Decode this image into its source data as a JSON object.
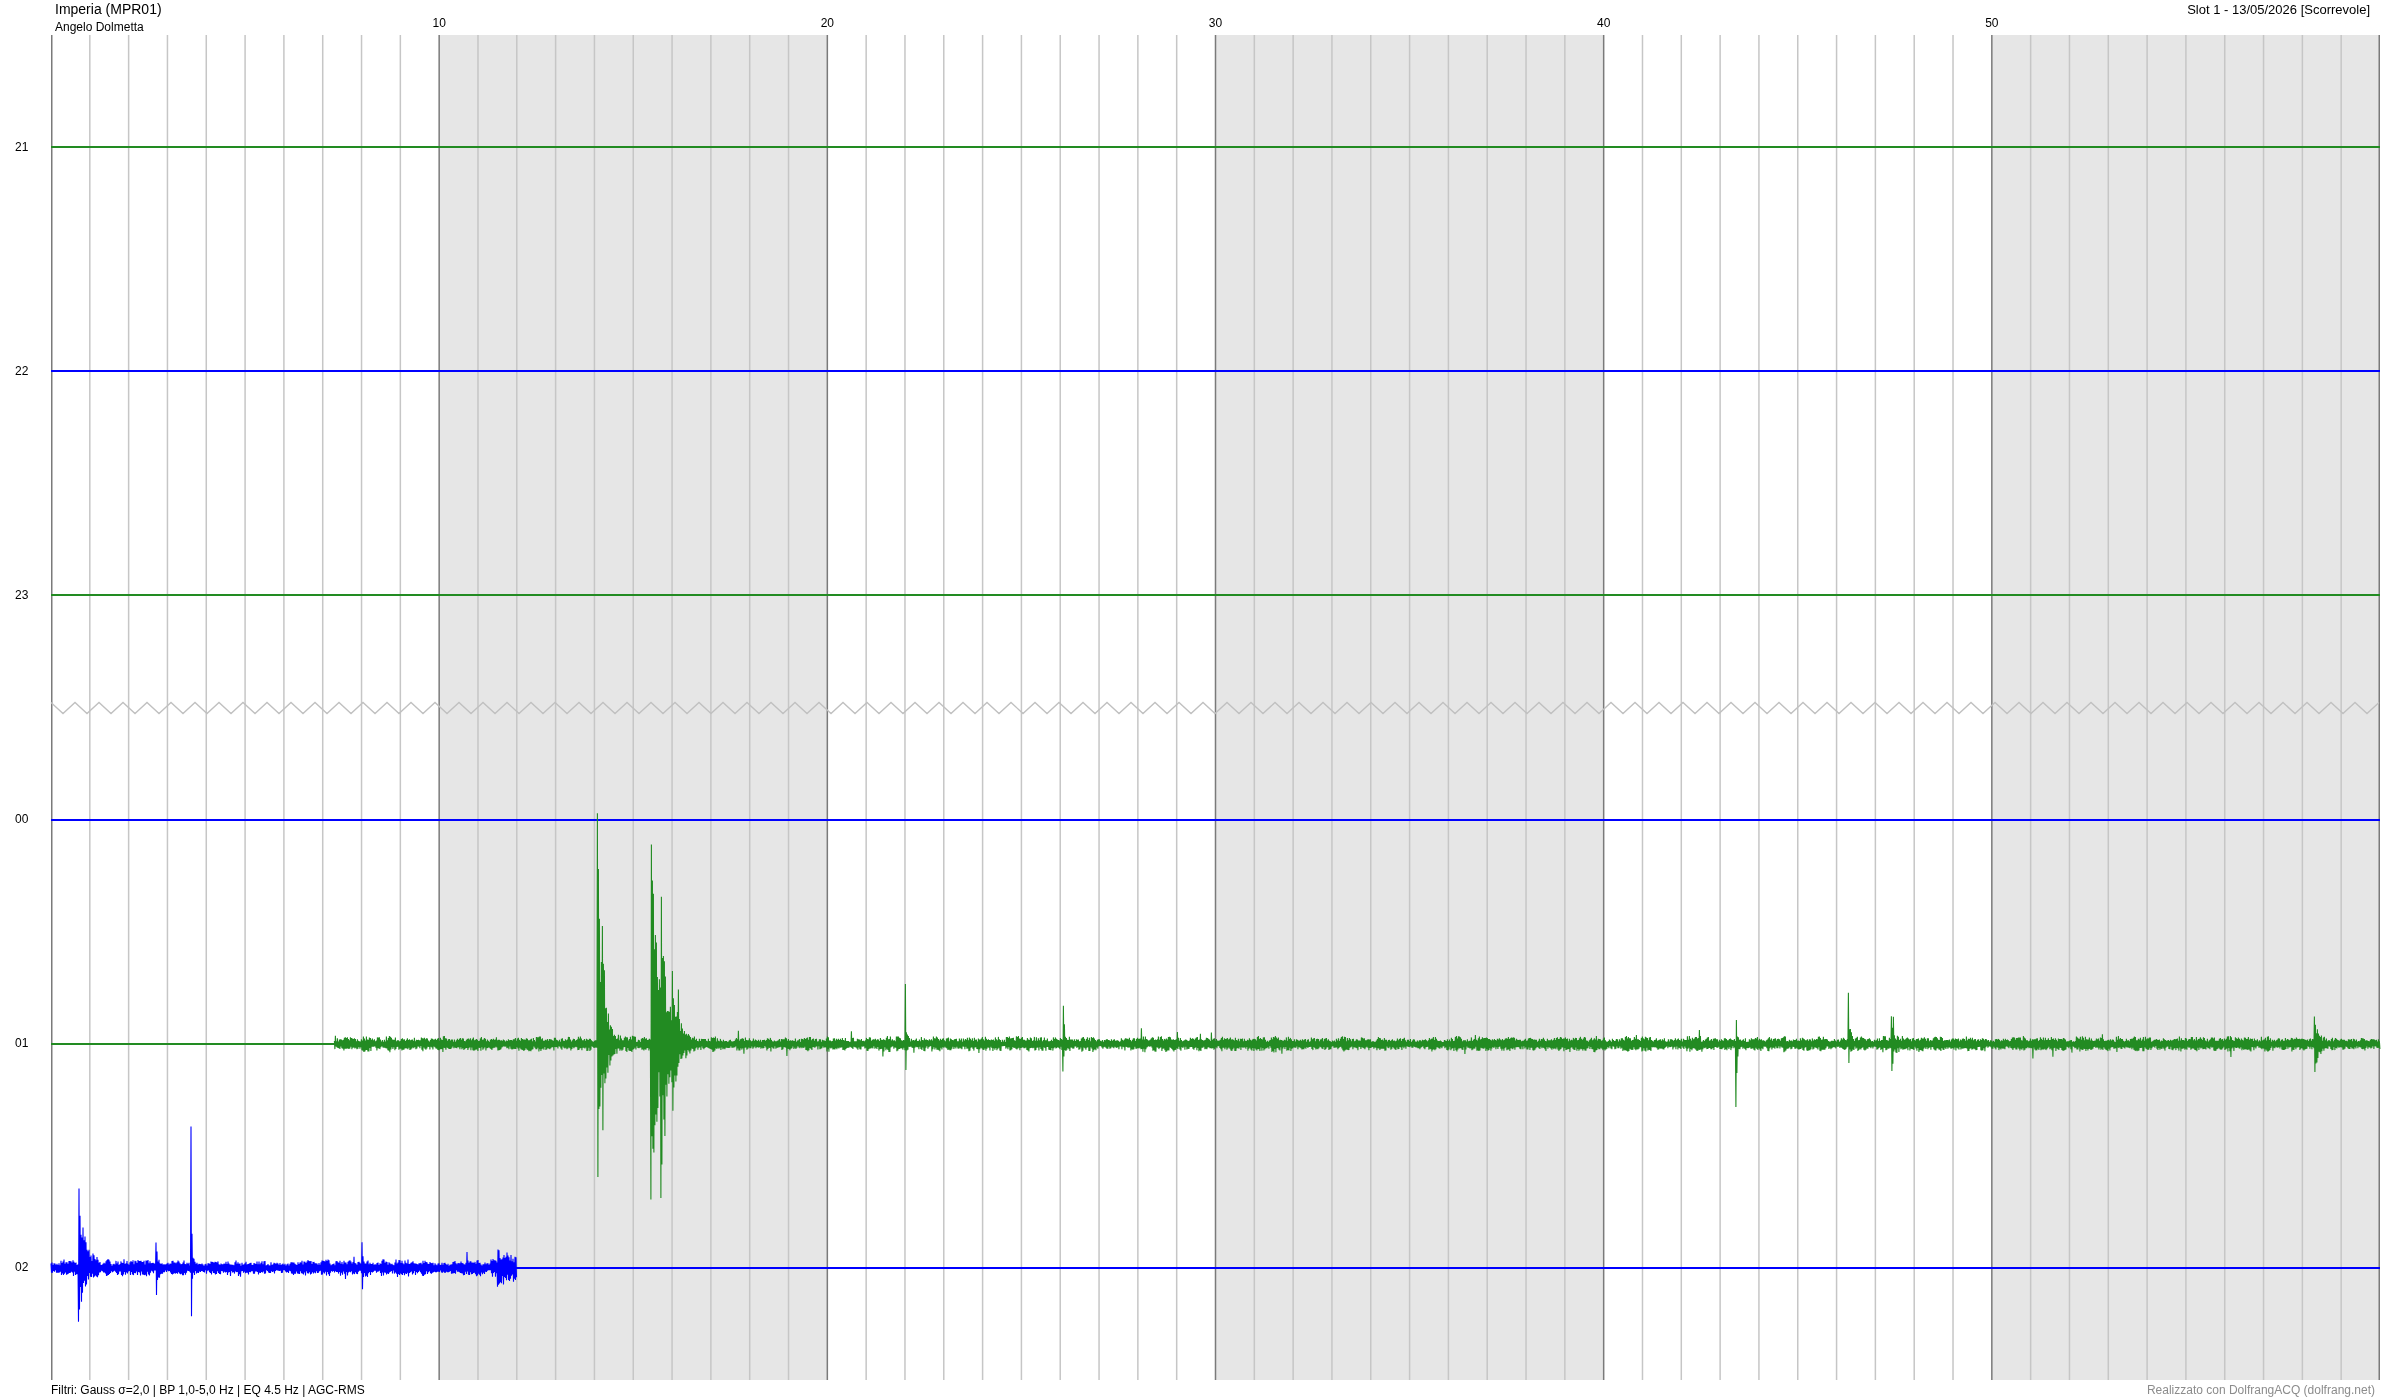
{
  "header": {
    "station": "Imperia (MPR01)",
    "operator": "Angelo Dolmetta",
    "slot": "Slot 1 - 13/05/2026 [Scorrevole]"
  },
  "helicorder": {
    "minute_labels": [
      "10",
      "20",
      "30",
      "40",
      "50"
    ],
    "rows": [
      {
        "hour": "21",
        "color": "#228b22",
        "kind": "flat",
        "day_break": false
      },
      {
        "hour": "22",
        "color": "#0000ff",
        "kind": "flat",
        "day_break": false
      },
      {
        "hour": "23",
        "color": "#228b22",
        "kind": "flat",
        "day_break": false
      },
      {
        "hour": "00",
        "color": "#0000ff",
        "kind": "flat",
        "day_break": true
      },
      {
        "hour": "01",
        "color": "#228b22",
        "kind": "trace",
        "day_break": false
      },
      {
        "hour": "02",
        "color": "#0000ff",
        "kind": "trace",
        "day_break": false
      }
    ]
  },
  "footer": {
    "filters": "Filtri: Gauss σ=2,0 | BP 1,0-5,0 Hz | EQ 4.5 Hz | AGC-RMS",
    "credit": "Realizzato con DolfrangACQ (dolfrang.net)"
  }
}
